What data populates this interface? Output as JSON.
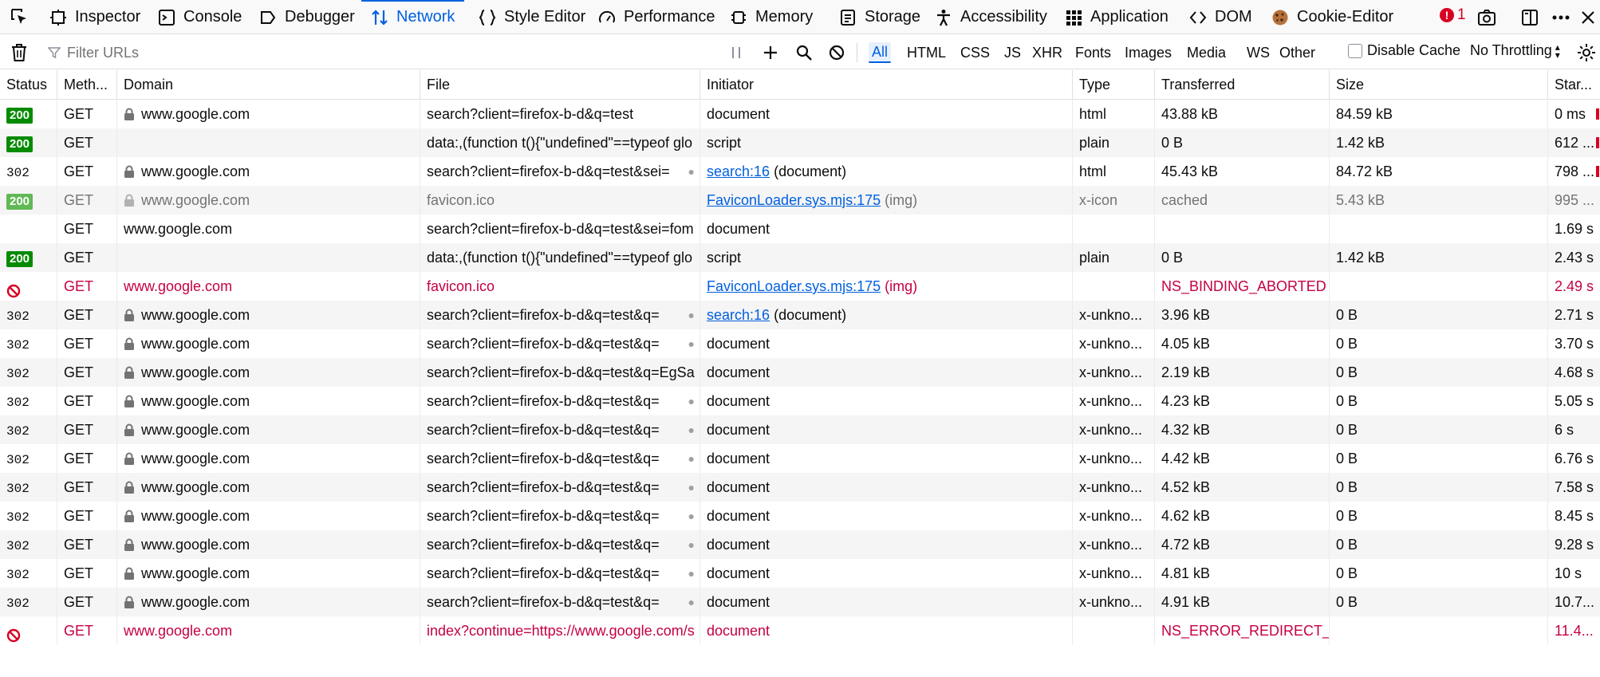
{
  "tabs": [
    {
      "label": "Inspector",
      "icon": "inspector-icon"
    },
    {
      "label": "Console",
      "icon": "console-icon"
    },
    {
      "label": "Debugger",
      "icon": "debugger-icon"
    },
    {
      "label": "Network",
      "icon": "network-icon",
      "active": true
    },
    {
      "label": "Style Editor",
      "icon": "style-editor-icon"
    },
    {
      "label": "Performance",
      "icon": "performance-icon"
    },
    {
      "label": "Memory",
      "icon": "memory-icon"
    },
    {
      "label": "Storage",
      "icon": "storage-icon"
    },
    {
      "label": "Accessibility",
      "icon": "accessibility-icon"
    },
    {
      "label": "Application",
      "icon": "application-icon"
    },
    {
      "label": "DOM",
      "icon": "dom-icon"
    },
    {
      "label": "Cookie-Editor",
      "icon": "cookie-icon"
    }
  ],
  "error_count": "1",
  "toolbar": {
    "filter_placeholder": "Filter URLs",
    "filter_types": [
      "All",
      "HTML",
      "CSS",
      "JS",
      "XHR",
      "Fonts",
      "Images",
      "Media",
      "WS",
      "Other"
    ],
    "active_filter": "All",
    "disable_cache_label": "Disable Cache",
    "throttle_label": "No Throttling"
  },
  "columns": [
    "Status",
    "Meth...",
    "Domain",
    "File",
    "Initiator",
    "Type",
    "Transferred",
    "Size",
    "Star..."
  ],
  "rows": [
    {
      "status": "200",
      "kind": "ok",
      "method": "GET",
      "lock": true,
      "domain": "www.google.com",
      "file": "search?client=firefox-b-d&q=test",
      "initiator": "document",
      "initiator_link": "",
      "initiator_suffix": "",
      "type": "html",
      "transferred": "43.88 kB",
      "size": "84.59 kB",
      "start": "0 ms"
    },
    {
      "status": "200",
      "kind": "ok",
      "method": "GET",
      "lock": false,
      "domain": "",
      "file": "data:,(function t(){\"undefined\"==typeof glo",
      "initiator": "script",
      "initiator_link": "",
      "initiator_suffix": "",
      "type": "plain",
      "transferred": "0 B",
      "size": "1.42 kB",
      "start": "612 ..."
    },
    {
      "status": "302",
      "kind": "redirect",
      "method": "GET",
      "lock": true,
      "domain": "www.google.com",
      "file": "search?client=firefox-b-d&q=test&sei=",
      "tracker": true,
      "initiator": "",
      "initiator_link": "search:16",
      "initiator_suffix": "(document)",
      "type": "html",
      "transferred": "45.43 kB",
      "size": "84.72 kB",
      "start": "798 ..."
    },
    {
      "status": "200",
      "kind": "cached",
      "method": "GET",
      "lock": true,
      "domain": "www.google.com",
      "file": "favicon.ico",
      "initiator": "",
      "initiator_link": "FaviconLoader.sys.mjs:175",
      "initiator_suffix": "(img)",
      "type": "x-icon",
      "transferred": "cached",
      "size": "5.43 kB",
      "start": "995 ..."
    },
    {
      "status": "",
      "kind": "pending",
      "method": "GET",
      "lock": false,
      "domain": "www.google.com",
      "file": "search?client=firefox-b-d&q=test&sei=fom",
      "initiator": "document",
      "initiator_link": "",
      "initiator_suffix": "",
      "type": "",
      "transferred": "",
      "size": "",
      "start": "1.69 s"
    },
    {
      "status": "200",
      "kind": "ok",
      "method": "GET",
      "lock": false,
      "domain": "",
      "file": "data:,(function t(){\"undefined\"==typeof glo",
      "initiator": "script",
      "initiator_link": "",
      "initiator_suffix": "",
      "type": "plain",
      "transferred": "0 B",
      "size": "1.42 kB",
      "start": "2.43 s"
    },
    {
      "status": "",
      "kind": "blocked",
      "method": "GET",
      "lock": false,
      "domain": "www.google.com",
      "file": "favicon.ico",
      "initiator": "",
      "initiator_link": "FaviconLoader.sys.mjs:175",
      "initiator_suffix": "(img)",
      "type": "",
      "transferred": "NS_BINDING_ABORTED",
      "size": "",
      "start": "2.49 s"
    },
    {
      "status": "302",
      "kind": "redirect",
      "method": "GET",
      "lock": true,
      "domain": "www.google.com",
      "file": "search?client=firefox-b-d&q=test&q=",
      "tracker": true,
      "initiator": "",
      "initiator_link": "search:16",
      "initiator_suffix": "(document)",
      "type": "x-unkno...",
      "transferred": "3.96 kB",
      "size": "0 B",
      "start": "2.71 s"
    },
    {
      "status": "302",
      "kind": "redirect",
      "method": "GET",
      "lock": true,
      "domain": "www.google.com",
      "file": "search?client=firefox-b-d&q=test&q=",
      "tracker": true,
      "initiator": "document",
      "initiator_link": "",
      "initiator_suffix": "",
      "type": "x-unkno...",
      "transferred": "4.05 kB",
      "size": "0 B",
      "start": "3.70 s"
    },
    {
      "status": "302",
      "kind": "redirect",
      "method": "GET",
      "lock": true,
      "domain": "www.google.com",
      "file": "search?client=firefox-b-d&q=test&q=EgSa",
      "initiator": "document",
      "initiator_link": "",
      "initiator_suffix": "",
      "type": "x-unkno...",
      "transferred": "2.19 kB",
      "size": "0 B",
      "start": "4.68 s"
    },
    {
      "status": "302",
      "kind": "redirect",
      "method": "GET",
      "lock": true,
      "domain": "www.google.com",
      "file": "search?client=firefox-b-d&q=test&q=",
      "tracker": true,
      "initiator": "document",
      "initiator_link": "",
      "initiator_suffix": "",
      "type": "x-unkno...",
      "transferred": "4.23 kB",
      "size": "0 B",
      "start": "5.05 s"
    },
    {
      "status": "302",
      "kind": "redirect",
      "method": "GET",
      "lock": true,
      "domain": "www.google.com",
      "file": "search?client=firefox-b-d&q=test&q=",
      "tracker": true,
      "initiator": "document",
      "initiator_link": "",
      "initiator_suffix": "",
      "type": "x-unkno...",
      "transferred": "4.32 kB",
      "size": "0 B",
      "start": "6 s"
    },
    {
      "status": "302",
      "kind": "redirect",
      "method": "GET",
      "lock": true,
      "domain": "www.google.com",
      "file": "search?client=firefox-b-d&q=test&q=",
      "tracker": true,
      "initiator": "document",
      "initiator_link": "",
      "initiator_suffix": "",
      "type": "x-unkno...",
      "transferred": "4.42 kB",
      "size": "0 B",
      "start": "6.76 s"
    },
    {
      "status": "302",
      "kind": "redirect",
      "method": "GET",
      "lock": true,
      "domain": "www.google.com",
      "file": "search?client=firefox-b-d&q=test&q=",
      "tracker": true,
      "initiator": "document",
      "initiator_link": "",
      "initiator_suffix": "",
      "type": "x-unkno...",
      "transferred": "4.52 kB",
      "size": "0 B",
      "start": "7.58 s"
    },
    {
      "status": "302",
      "kind": "redirect",
      "method": "GET",
      "lock": true,
      "domain": "www.google.com",
      "file": "search?client=firefox-b-d&q=test&q=",
      "tracker": true,
      "initiator": "document",
      "initiator_link": "",
      "initiator_suffix": "",
      "type": "x-unkno...",
      "transferred": "4.62 kB",
      "size": "0 B",
      "start": "8.45 s"
    },
    {
      "status": "302",
      "kind": "redirect",
      "method": "GET",
      "lock": true,
      "domain": "www.google.com",
      "file": "search?client=firefox-b-d&q=test&q=",
      "tracker": true,
      "initiator": "document",
      "initiator_link": "",
      "initiator_suffix": "",
      "type": "x-unkno...",
      "transferred": "4.72 kB",
      "size": "0 B",
      "start": "9.28 s"
    },
    {
      "status": "302",
      "kind": "redirect",
      "method": "GET",
      "lock": true,
      "domain": "www.google.com",
      "file": "search?client=firefox-b-d&q=test&q=",
      "tracker": true,
      "initiator": "document",
      "initiator_link": "",
      "initiator_suffix": "",
      "type": "x-unkno...",
      "transferred": "4.81 kB",
      "size": "0 B",
      "start": "10 s"
    },
    {
      "status": "302",
      "kind": "redirect",
      "method": "GET",
      "lock": true,
      "domain": "www.google.com",
      "file": "search?client=firefox-b-d&q=test&q=",
      "tracker": true,
      "initiator": "document",
      "initiator_link": "",
      "initiator_suffix": "",
      "type": "x-unkno...",
      "transferred": "4.91 kB",
      "size": "0 B",
      "start": "10.7..."
    },
    {
      "status": "",
      "kind": "blocked",
      "method": "GET",
      "lock": false,
      "domain": "www.google.com",
      "file": "index?continue=https://www.google.com/s",
      "initiator": "document",
      "initiator_link": "",
      "initiator_suffix": "",
      "type": "",
      "transferred": "NS_ERROR_REDIRECT_L...",
      "size": "",
      "start": "11.4..."
    }
  ],
  "colors": {
    "accent": "#0060df",
    "ok_badge": "#058b00",
    "error": "#c50042"
  }
}
